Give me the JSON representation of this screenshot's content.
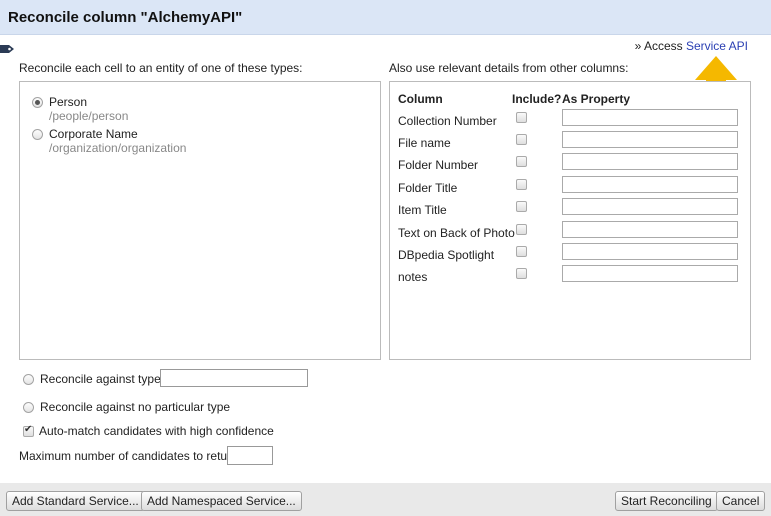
{
  "dialog": {
    "title": "Reconcile column \"AlchemyAPI\"",
    "access_prefix": "» Access",
    "access_link": "Service API"
  },
  "types_panel": {
    "heading": "Reconcile each cell to an entity of one of these types:",
    "types": [
      {
        "name": "Person",
        "id": "/people/person",
        "selected": true
      },
      {
        "name": "Corporate Name",
        "id": "/organization/organization",
        "selected": false
      }
    ]
  },
  "columns_panel": {
    "heading": "Also use relevant details from other columns:",
    "headers": {
      "column": "Column",
      "include": "Include?",
      "as_property": "As Property"
    },
    "rows": [
      {
        "name": "Collection Number",
        "include": false,
        "property": ""
      },
      {
        "name": "File name",
        "include": false,
        "property": ""
      },
      {
        "name": "Folder Number",
        "include": false,
        "property": ""
      },
      {
        "name": "Folder Title",
        "include": false,
        "property": ""
      },
      {
        "name": "Item Title",
        "include": false,
        "property": ""
      },
      {
        "name": "Text on Back of Photo",
        "include": false,
        "property": ""
      },
      {
        "name": "DBpedia Spotlight",
        "include": false,
        "property": ""
      },
      {
        "name": "notes",
        "include": false,
        "property": ""
      }
    ]
  },
  "options": {
    "against_type_label": "Reconcile against type:",
    "against_type_value": "",
    "no_type_label": "Reconcile against no particular type",
    "automatch_label": "Auto-match candidates with high confidence",
    "automatch_checked": true,
    "max_candidates_label": "Maximum number of candidates to return",
    "max_candidates_value": ""
  },
  "footer": {
    "add_standard": "Add Standard Service...",
    "add_namespaced": "Add Namespaced Service...",
    "start": "Start Reconciling",
    "cancel": "Cancel"
  },
  "colors": {
    "header_bg": "#dbe6f6",
    "link": "#2a3fb3",
    "annotation_arrow": "#f5b800"
  },
  "icons": {
    "tag": "tag-icon",
    "annotation": "arrow-up-icon"
  }
}
